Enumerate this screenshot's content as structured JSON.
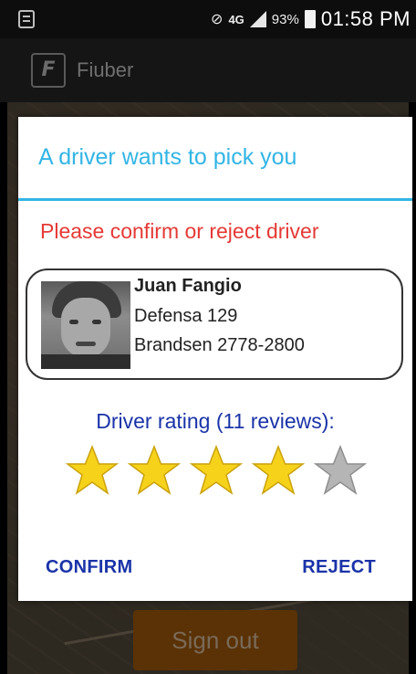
{
  "status_bar": {
    "network": "4G",
    "battery_percent": "93%",
    "time": "01:58 PM"
  },
  "app_bar": {
    "title": "Fiuber",
    "logo_glyph": "F"
  },
  "background": {
    "signout_label": "Sign out"
  },
  "dialog": {
    "title": "A driver wants to pick you",
    "message": "Please confirm or reject driver",
    "driver": {
      "name": "Juan Fangio",
      "address_line1": "Defensa 129",
      "address_line2": "Brandsen 2778-2800"
    },
    "rating_label": "Driver rating (11  reviews):",
    "rating": {
      "value": 4,
      "max": 5,
      "filled_color": "#f7d21b",
      "empty_color": "#b5b5b5"
    },
    "confirm_label": "CONFIRM",
    "reject_label": "REJECT"
  },
  "colors": {
    "accent": "#33b5e5",
    "warning_text": "#e53935",
    "button_text": "#1a33a8"
  }
}
